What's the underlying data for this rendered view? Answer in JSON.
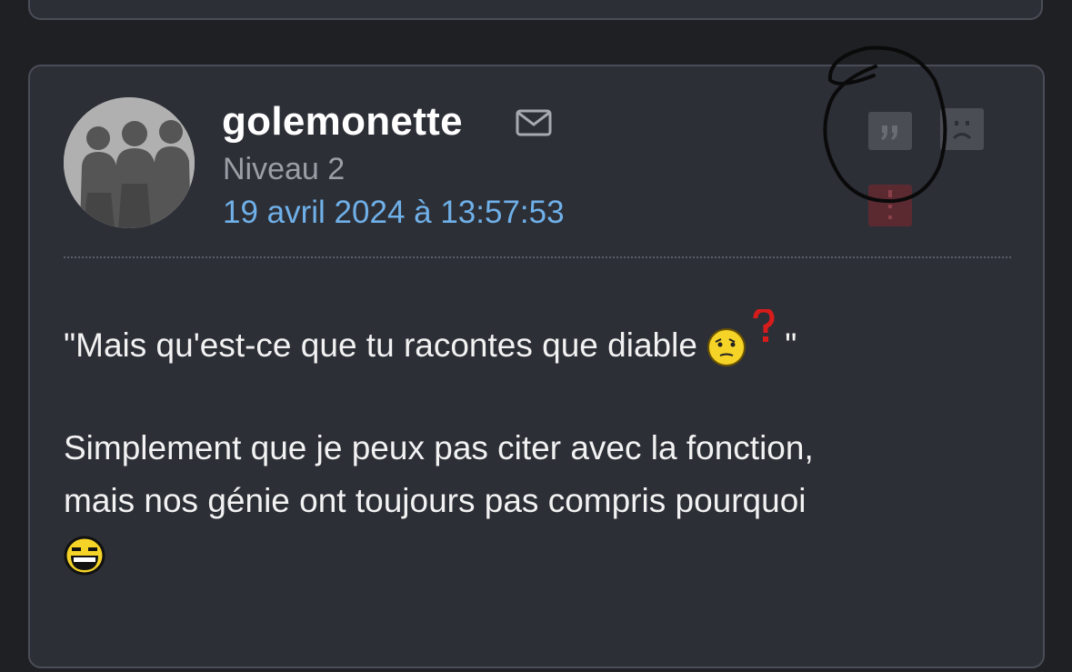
{
  "post": {
    "username": "golemonette",
    "level": "Niveau 2",
    "date": "19 avril 2024 à 13:57:53",
    "paragraph1": {
      "before": "\"Mais qu'est-ce que tu racontes que diable",
      "after": "\""
    },
    "paragraph2": {
      "line1": "Simplement que je peux pas citer avec la fonction,",
      "line2": "mais nos génie ont toujours pas compris pourquoi"
    },
    "quote_glyph": "”"
  },
  "icons": {
    "mail": "mail-icon",
    "quote": "quote-icon",
    "sad": "sad-face-icon",
    "more": "more-vertical-icon",
    "emoji1": "thinking-question-emoji",
    "emoji2": "laughing-emoji"
  },
  "colors": {
    "background": "#1f2024",
    "card": "#2d2f37",
    "username": "#ffffff",
    "level": "#9c9ea6",
    "date": "#6fb0e8",
    "alert_button": "#5b2a31"
  }
}
